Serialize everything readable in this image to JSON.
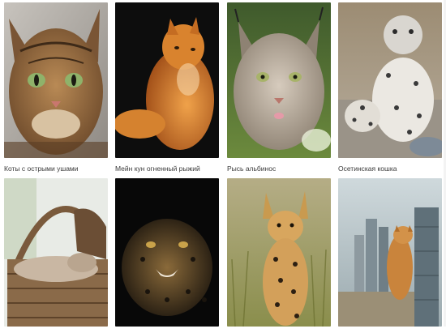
{
  "gallery": {
    "items": [
      {
        "caption": "Коты с острыми ушами",
        "icon": "bengal-cat-photo"
      },
      {
        "caption": "Мейн кун огненный рыжий",
        "icon": "maine-coon-photo"
      },
      {
        "caption": "Рысь альбинос",
        "icon": "lynx-photo"
      },
      {
        "caption": "Осетинская кошка",
        "icon": "snow-leopard-photo"
      },
      {
        "caption": "",
        "icon": "cat-in-basket-photo"
      },
      {
        "caption": "",
        "icon": "leopard-photo"
      },
      {
        "caption": "",
        "icon": "serval-photo"
      },
      {
        "caption": "",
        "icon": "giant-cat-city-photo"
      }
    ]
  }
}
